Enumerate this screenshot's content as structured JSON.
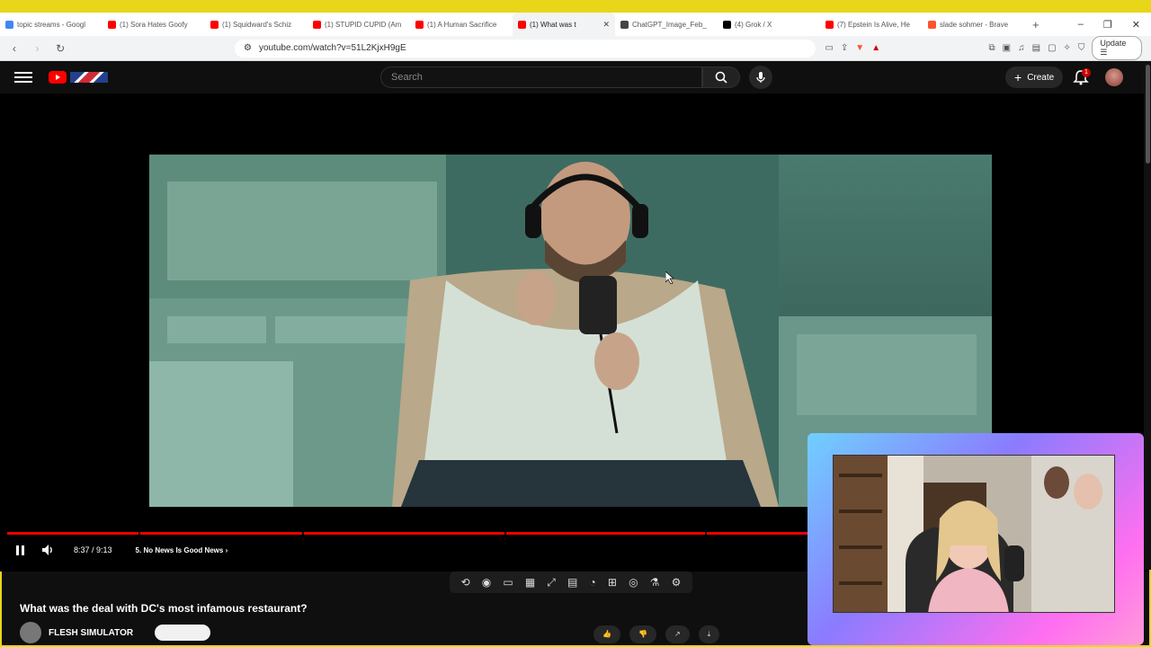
{
  "browser": {
    "tabs": [
      {
        "title": "topic streams - Googl",
        "fav_color": "#4285f4"
      },
      {
        "title": "(1) Sora Hates Goofy",
        "fav_color": "#ff0000"
      },
      {
        "title": "(1) Squidward's Schiz",
        "fav_color": "#ff0000"
      },
      {
        "title": "(1) STUPID CUPID (Am",
        "fav_color": "#ff0000"
      },
      {
        "title": "(1) A Human Sacrifice",
        "fav_color": "#ff0000"
      },
      {
        "title": "(1) What was t",
        "fav_color": "#ff0000",
        "active": true,
        "close": "✕"
      },
      {
        "title": "ChatGPT_Image_Feb_",
        "fav_color": "#444444"
      },
      {
        "title": "(4) Grok / X",
        "fav_color": "#000000"
      },
      {
        "title": "(7) Epstein Is Alive, He",
        "fav_color": "#ff0000"
      },
      {
        "title": "slade sohmer - Brave",
        "fav_color": "#fb542b"
      }
    ],
    "new_tab": "+",
    "window_controls": [
      "–",
      "❐",
      "✕"
    ],
    "url": "youtube.com/watch?v=51L2KjxH9gE",
    "update_label": "Update"
  },
  "youtube": {
    "search_placeholder": "Search",
    "create_label": "Create",
    "notif_count": "1",
    "player": {
      "time": "8:37 / 9:13",
      "chapter": "5. No News Is Good News",
      "progress_fraction": 0.94
    },
    "video_title": "What was the deal with DC's most infamous restaurant?",
    "channel_name": "FLESH SIMULATOR"
  },
  "ext_icons": [
    "loop-icon",
    "audio-icon",
    "screen-icon",
    "film-icon",
    "resize-icon",
    "layout-icon",
    "speed-icon",
    "pip-icon",
    "camera-icon",
    "flask-icon",
    "gear-icon"
  ],
  "colors": {
    "accent_red": "#ff0000",
    "frame_yellow": "#e8d61a"
  }
}
